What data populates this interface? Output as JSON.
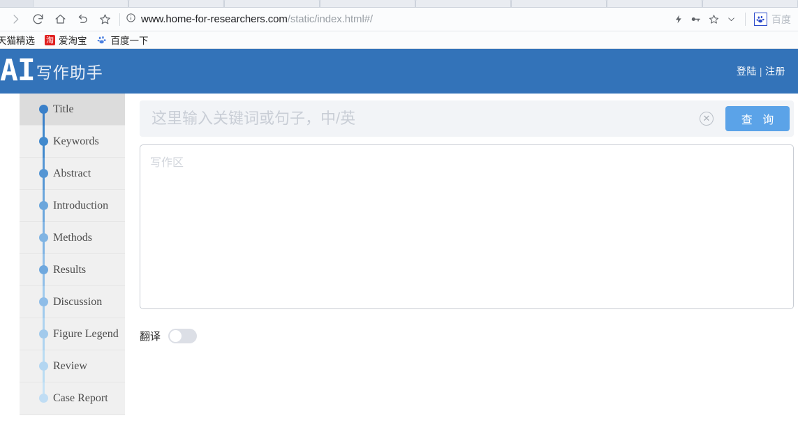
{
  "browser": {
    "nav_icons": [
      {
        "name": "forward-icon",
        "label": "Forward"
      },
      {
        "name": "reload-icon",
        "label": "Reload"
      },
      {
        "name": "home-icon",
        "label": "Home"
      },
      {
        "name": "undo-icon",
        "label": "Back"
      },
      {
        "name": "bookmark-star-icon",
        "label": "Bookmark"
      }
    ],
    "security_icon": "info-circle-icon",
    "url_main": "www.home-for-researchers.com",
    "url_path": "/static/index.html#/",
    "omnibox_icons": [
      {
        "name": "lightning-icon"
      },
      {
        "name": "key-icon"
      },
      {
        "name": "star-icon"
      },
      {
        "name": "chevron-down-icon"
      }
    ],
    "extension": {
      "icon": "baidu-paw-icon",
      "label": "百度"
    },
    "bookmarks": [
      {
        "label": "天猫精选",
        "icon": "none"
      },
      {
        "label": "爱淘宝",
        "icon": "taobao-icon",
        "icon_text": "淘"
      },
      {
        "label": "百度一下",
        "icon": "baidu-paw-icon"
      }
    ],
    "tab_count": 9
  },
  "header": {
    "logo_mark": "AI",
    "logo_text": "写作助手",
    "login_label": "登陆",
    "separator": "|",
    "register_label": "注册",
    "bg_color": "#3373b9"
  },
  "sidebar": {
    "items": [
      {
        "label": "Title",
        "active": true,
        "dot_color": "#3a80c9",
        "line_color": "#3a80c9"
      },
      {
        "label": "Keywords",
        "active": false,
        "dot_color": "#4189cd",
        "line_color": "#4189cd"
      },
      {
        "label": "Abstract",
        "active": false,
        "dot_color": "#5596d4",
        "line_color": "#5596d4"
      },
      {
        "label": "Introduction",
        "active": false,
        "dot_color": "#6ba6dc",
        "line_color": "#6ba6dc"
      },
      {
        "label": "Methods",
        "active": false,
        "dot_color": "#80b4e3",
        "line_color": "#80b4e3"
      },
      {
        "label": "Results",
        "active": false,
        "dot_color": "#6fa8de",
        "line_color": "#90bfe8"
      },
      {
        "label": "Discussion",
        "active": false,
        "dot_color": "#8fbde8",
        "line_color": "#a0cbed"
      },
      {
        "label": "Figure Legend",
        "active": false,
        "dot_color": "#a2caec",
        "line_color": "#aed3f0"
      },
      {
        "label": "Review",
        "active": false,
        "dot_color": "#b3d6f1",
        "line_color": "#badcf3"
      },
      {
        "label": "Case Report",
        "active": false,
        "dot_color": "#c0ddf4",
        "line_color": "#c6e2f6"
      }
    ]
  },
  "main": {
    "search": {
      "value": "",
      "placeholder": "这里输入关键词或句子，中/英",
      "clear_icon": "close-circle-icon",
      "button_label": "查 询",
      "button_color": "#5ba3e8"
    },
    "editor": {
      "value": "",
      "placeholder": "写作区"
    },
    "translate": {
      "label": "翻译",
      "enabled": false
    }
  }
}
